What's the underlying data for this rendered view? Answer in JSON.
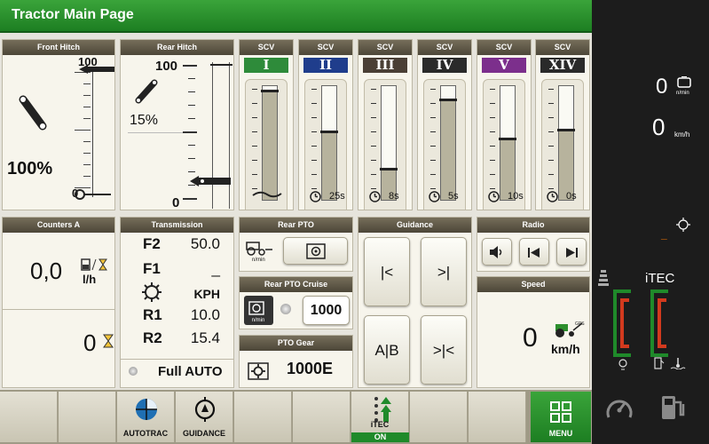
{
  "title": "Tractor Main Page",
  "front_hitch": {
    "header": "Front Hitch",
    "max": "100",
    "min": "0",
    "percent": "100%",
    "level": 1.0
  },
  "rear_hitch": {
    "header": "Rear Hitch",
    "max": "100",
    "min": "0",
    "percent": "15%",
    "level": 0.15
  },
  "scv": [
    {
      "header": "SCV",
      "numeral": "I",
      "color": "#2e8b3a",
      "timer": "",
      "level": 0.96
    },
    {
      "header": "SCV",
      "numeral": "II",
      "color": "#1f3d8c",
      "timer": "25s",
      "level": 0.6
    },
    {
      "header": "SCV",
      "numeral": "III",
      "color": "#4a3f35",
      "timer": "8s",
      "level": 0.27
    },
    {
      "header": "SCV",
      "numeral": "IV",
      "color": "#2a2a2a",
      "timer": "5s",
      "level": 0.88
    },
    {
      "header": "SCV",
      "numeral": "V",
      "color": "#7c2f8c",
      "timer": "10s",
      "level": 0.54
    },
    {
      "header": "SCV",
      "numeral": "XIV",
      "color": "#2a2a2a",
      "timer": "0s",
      "level": 0.62
    }
  ],
  "counters": {
    "header": "Counters A",
    "value1": "0,0",
    "unit1": "l/h",
    "value2": "0"
  },
  "transmission": {
    "header": "Transmission",
    "rows": [
      {
        "label": "F2",
        "value": "50.0"
      },
      {
        "label": "F1",
        "value": "_"
      },
      {
        "label": "",
        "value": "KPH"
      },
      {
        "label": "R1",
        "value": "10.0"
      },
      {
        "label": "R2",
        "value": "15.4"
      }
    ],
    "mode": "Full AUTO"
  },
  "rear_pto": {
    "header": "Rear PTO",
    "icon_label": "n/min"
  },
  "rear_pto_cruise": {
    "header": "Rear PTO Cruise",
    "value": "1000",
    "icon_label": "n/min"
  },
  "pto_gear": {
    "header": "PTO Gear",
    "value": "1000E"
  },
  "guidance": {
    "header": "Guidance",
    "buttons": [
      "|<",
      ">|",
      "A|B",
      ">|<"
    ]
  },
  "radio": {
    "header": "Radio"
  },
  "speed": {
    "header": "Speed",
    "value": "0",
    "unit": "km/h"
  },
  "bottom": {
    "autotrac": "AUTOTRAC",
    "guidance": "GUIDANCE",
    "itec": "iTEC",
    "itec_state": "ON",
    "menu": "MENU"
  },
  "side": {
    "rpm": "0",
    "rpm_unit": "n/min",
    "speed": "0",
    "speed_unit": "km/h",
    "itec": "iTEC",
    "dash": "_"
  },
  "colors": {
    "green": "#1f8a2a",
    "orange": "#ff7a00",
    "red": "#d23a1e"
  }
}
